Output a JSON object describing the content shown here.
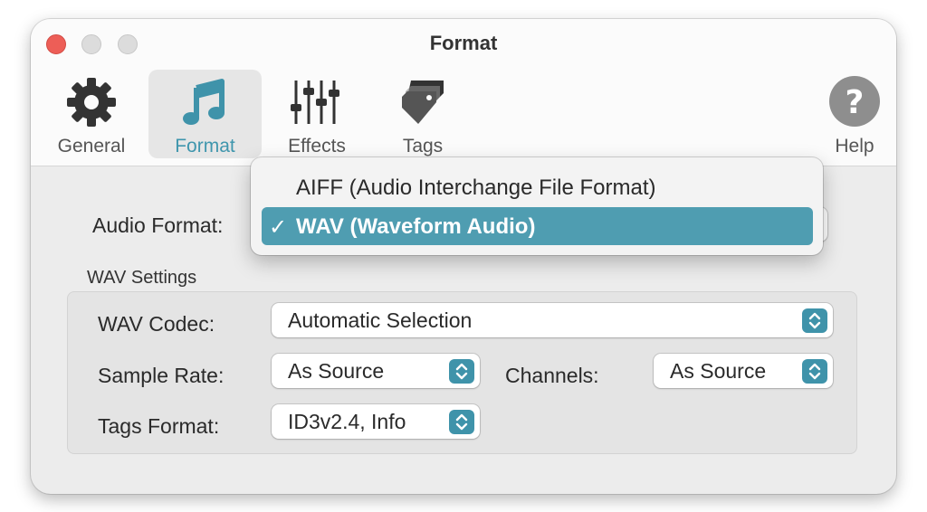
{
  "window": {
    "title": "Format"
  },
  "toolbar": {
    "items": [
      {
        "label": "General",
        "icon": "gear-icon"
      },
      {
        "label": "Format",
        "icon": "music-note-icon",
        "selected": true
      },
      {
        "label": "Effects",
        "icon": "sliders-icon"
      },
      {
        "label": "Tags",
        "icon": "tag-icon"
      }
    ],
    "help": {
      "label": "Help",
      "icon": "help-icon"
    }
  },
  "audio_format": {
    "label": "Audio Format:",
    "value": "WAV (Waveform Audio)",
    "options": [
      {
        "label": "AIFF (Audio Interchange File Format)",
        "selected": false
      },
      {
        "label": "WAV (Waveform Audio)",
        "selected": true,
        "check": "✓"
      }
    ]
  },
  "wav_settings": {
    "title": "WAV Settings",
    "codec": {
      "label": "WAV Codec:",
      "value": "Automatic Selection"
    },
    "sample_rate": {
      "label": "Sample Rate:",
      "value": "As Source"
    },
    "channels": {
      "label": "Channels:",
      "value": "As Source"
    },
    "tags_format": {
      "label": "Tags Format:",
      "value": "ID3v2.4, Info"
    }
  },
  "colors": {
    "accent": "#3f96ad",
    "menu_highlight": "#4f9db1",
    "close_button": "#ed5e57"
  }
}
